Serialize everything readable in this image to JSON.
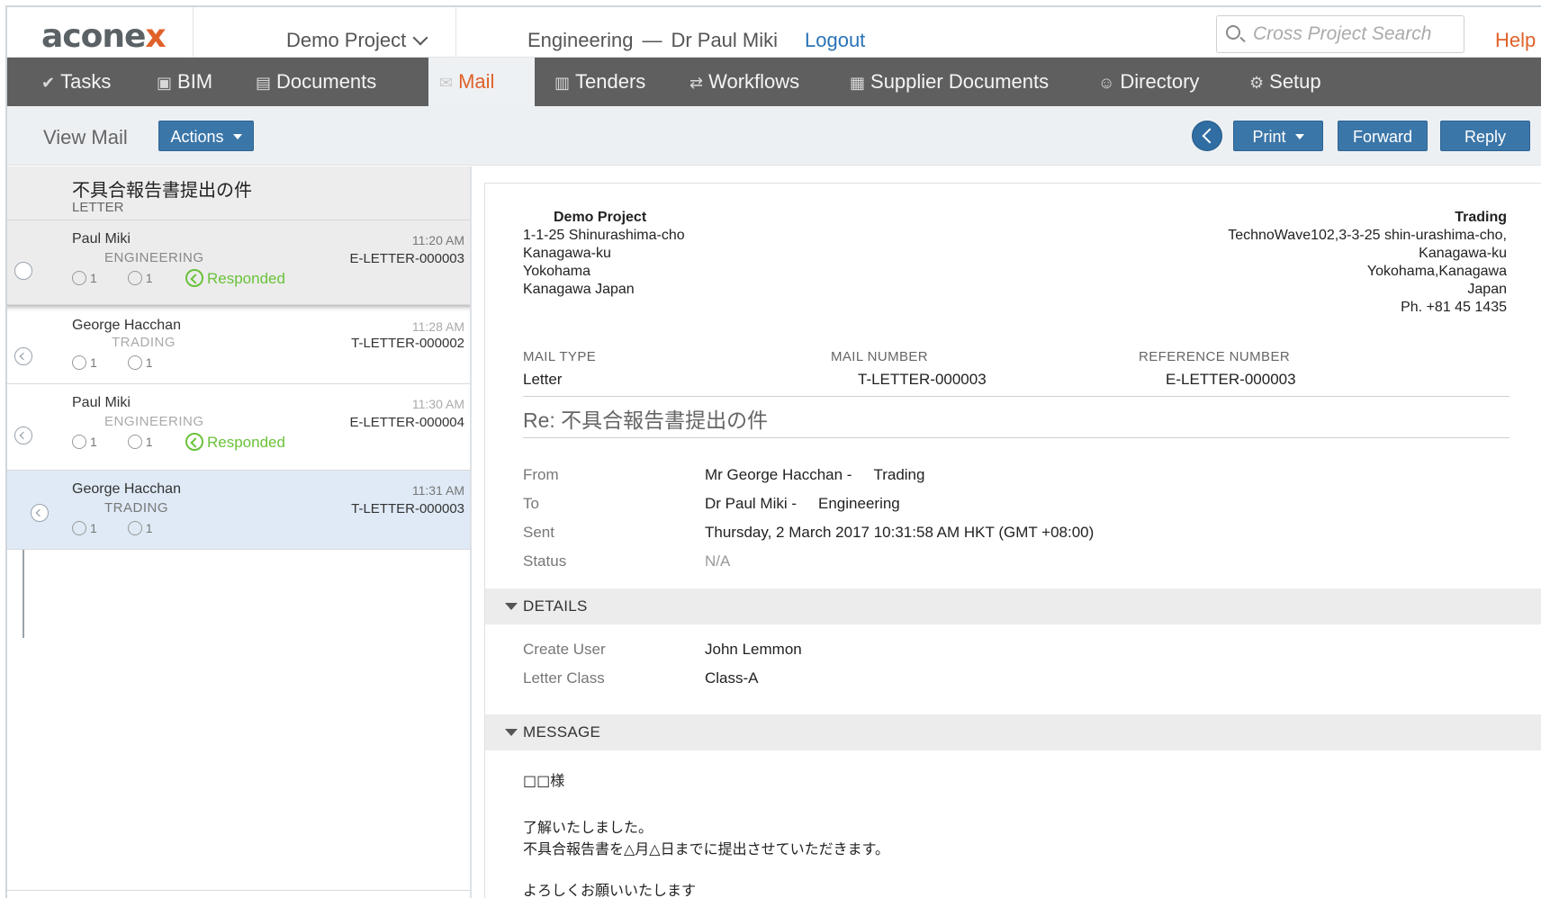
{
  "top": {
    "logo_main": "acone",
    "logo_x": "x",
    "project": "Demo Project",
    "org": "Engineering",
    "separator": "—",
    "user": "Dr Paul Miki",
    "logout": "Logout",
    "search_placeholder": "Cross Project Search",
    "help": "Help"
  },
  "nav": {
    "items": [
      {
        "label": "Tasks",
        "icon": "check-icon",
        "glyph": "✔"
      },
      {
        "label": "BIM",
        "icon": "cube-icon",
        "glyph": "▣"
      },
      {
        "label": "Documents",
        "icon": "document-icon",
        "glyph": "▤"
      },
      {
        "label": "Mail",
        "icon": "envelope-icon",
        "glyph": "✉"
      },
      {
        "label": "Tenders",
        "icon": "tender-icon",
        "glyph": "▥"
      },
      {
        "label": "Workflows",
        "icon": "workflow-icon",
        "glyph": "⇄"
      },
      {
        "label": "Supplier Documents",
        "icon": "supplier-docs-icon",
        "glyph": "▦"
      },
      {
        "label": "Directory",
        "icon": "people-icon",
        "glyph": "☺"
      },
      {
        "label": "Setup",
        "icon": "gear-icon",
        "glyph": "⚙"
      }
    ],
    "active": "Mail"
  },
  "toolbar": {
    "title": "View Mail",
    "actions": "Actions",
    "print": "Print",
    "forward": "Forward",
    "reply": "Reply"
  },
  "thread": {
    "subject": "不具合報告書提出の件",
    "type": "LETTER",
    "items": [
      {
        "name": "Paul Miki",
        "org": "ENGINEERING",
        "time": "11:20 AM",
        "number": "E-LETTER-000003",
        "count_a": "1",
        "count_b": "1",
        "responded": "Responded"
      },
      {
        "name": "George Hacchan",
        "org": "TRADING",
        "time": "11:28 AM",
        "number": "T-LETTER-000002",
        "count_a": "1",
        "count_b": "1",
        "responded": ""
      },
      {
        "name": "Paul Miki",
        "org": "ENGINEERING",
        "time": "11:30 AM",
        "number": "E-LETTER-000004",
        "count_a": "1",
        "count_b": "1",
        "responded": "Responded"
      },
      {
        "name": "George Hacchan",
        "org": "TRADING",
        "time": "11:31 AM",
        "number": "T-LETTER-000003",
        "count_a": "1",
        "count_b": "1",
        "responded": ""
      }
    ]
  },
  "mail": {
    "sender_addr": {
      "name": "Demo Project",
      "line1": "1-1-25 Shinurashima-cho",
      "line2": "Kanagawa-ku",
      "line3": "Yokohama",
      "line4": "Kanagawa Japan"
    },
    "recipient_addr": {
      "name": "Trading",
      "line1": "TechnoWave102,3-3-25 shin-urashima-cho,",
      "line2": "Kanagawa-ku",
      "line3": "Yokohama,Kanagawa",
      "line4": "Japan",
      "line5": "Ph. +81 45 1435"
    },
    "mail_type_label": "MAIL TYPE",
    "mail_type": "Letter",
    "mail_number_label": "MAIL NUMBER",
    "mail_number": "T-LETTER-000003",
    "reference_label": "REFERENCE NUMBER",
    "reference": "E-LETTER-000003",
    "subject": "Re: 不具合報告書提出の件",
    "from_label": "From",
    "from": "Mr George Hacchan -",
    "from_org": "Trading",
    "to_label": "To",
    "to": "Dr Paul Miki -",
    "to_org": "Engineering",
    "sent_label": "Sent",
    "sent": "Thursday, 2 March 2017 10:31:58 AM HKT (GMT +08:00)",
    "status_label": "Status",
    "status": "N/A",
    "details_label": "DETAILS",
    "create_user_label": "Create User",
    "create_user": "John Lemmon",
    "letter_class_label": "Letter Class",
    "letter_class": "Class-A",
    "message_label": "MESSAGE",
    "message_line1": "□□様",
    "message_line2": "了解いたしました。",
    "message_line3": "不具合報告書を△月△日までに提出させていただきます。",
    "message_line4": "よろしくお願いいたします"
  },
  "colors": {
    "accent": "#e0622a",
    "nav_bg": "#5f5f5f",
    "button": "#3b76a8",
    "responded": "#6ac23a",
    "selected_row": "#dfeaf6"
  }
}
